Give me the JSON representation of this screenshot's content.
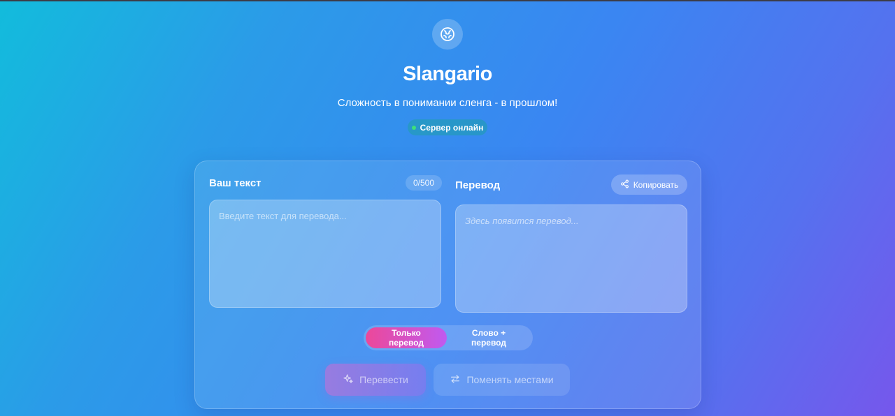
{
  "app": {
    "title": "Slangario",
    "tagline": "Сложность в понимании сленга - в прошлом!",
    "status": "Сервер онлайн",
    "logo_icon": "brain-icon"
  },
  "input_panel": {
    "label": "Ваш текст",
    "counter": "0/500",
    "value": "",
    "placeholder": "Введите текст для перевода..."
  },
  "output_panel": {
    "label": "Перевод",
    "copy_label": "Копировать",
    "copy_icon": "share-icon",
    "placeholder": "Здесь появится перевод..."
  },
  "mode_toggle": {
    "options": [
      "Только перевод",
      "Слово + перевод"
    ],
    "selected": "Только перевод"
  },
  "actions": {
    "translate_label": "Перевести",
    "translate_icon": "sparkles-icon",
    "swap_label": "Поменять местами",
    "swap_icon": "swap-arrows-icon"
  },
  "colors": {
    "status_dot": "#3ee07a",
    "accent_pink": "#ec4899",
    "accent_purple": "#c05af0"
  }
}
